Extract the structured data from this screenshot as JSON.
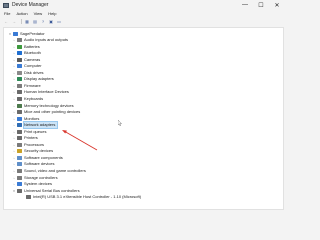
{
  "window": {
    "title": "Device Manager",
    "minimize_glyph": "—",
    "maximize_glyph": "☐",
    "close_glyph": "✕"
  },
  "menubar": {
    "items": [
      "File",
      "Action",
      "View",
      "Help"
    ]
  },
  "toolbar": {
    "buttons": [
      {
        "name": "back-icon",
        "glyph": "←"
      },
      {
        "name": "forward-icon",
        "glyph": "→"
      },
      {
        "name": "tree-view-icon",
        "glyph": "▦"
      },
      {
        "name": "properties-icon",
        "glyph": "▤"
      },
      {
        "name": "help-icon",
        "glyph": "?"
      },
      {
        "name": "scan-icon",
        "glyph": "▣"
      },
      {
        "name": "monitor-icon",
        "glyph": "▭"
      }
    ]
  },
  "tree": {
    "root": "SagePredator",
    "items": [
      {
        "label": "Audio inputs and outputs",
        "icon": "speaker-icon",
        "color": "#7a7a7a"
      },
      {
        "label": "Batteries",
        "icon": "battery-icon",
        "color": "#3d9a3d"
      },
      {
        "label": "Bluetooth",
        "icon": "bluetooth-icon",
        "color": "#1f6fd1"
      },
      {
        "label": "Cameras",
        "icon": "camera-icon",
        "color": "#5a5a5a"
      },
      {
        "label": "Computer",
        "icon": "computer-icon",
        "color": "#3a7bd5"
      },
      {
        "label": "Disk drives",
        "icon": "disk-drive-icon",
        "color": "#8a8a8a"
      },
      {
        "label": "Display adapters",
        "icon": "display-adapter-icon",
        "color": "#2e8b57"
      },
      {
        "label": "Firmware",
        "icon": "firmware-icon",
        "color": "#7c7c7c"
      },
      {
        "label": "Human Interface Devices",
        "icon": "hid-icon",
        "color": "#6a6a6a"
      },
      {
        "label": "Keyboards",
        "icon": "keyboard-icon",
        "color": "#6a6a6a"
      },
      {
        "label": "Memory technology devices",
        "icon": "memory-icon",
        "color": "#4d7a4d"
      },
      {
        "label": "Mice and other pointing devices",
        "icon": "mouse-icon",
        "color": "#6a6a6a"
      },
      {
        "label": "Monitors",
        "icon": "monitor-icon",
        "color": "#3a7bd5"
      },
      {
        "label": "Network adapters",
        "icon": "network-adapter-icon",
        "color": "#2f6db5"
      },
      {
        "label": "Print queues",
        "icon": "printer-icon",
        "color": "#6a6a6a"
      },
      {
        "label": "Printers",
        "icon": "printer-icon",
        "color": "#6a6a6a"
      },
      {
        "label": "Processors",
        "icon": "processor-icon",
        "color": "#7a7a7a"
      },
      {
        "label": "Security devices",
        "icon": "security-icon",
        "color": "#c9a227"
      },
      {
        "label": "Software components",
        "icon": "software-icon",
        "color": "#5f8fc9"
      },
      {
        "label": "Software devices",
        "icon": "software-icon",
        "color": "#5f8fc9"
      },
      {
        "label": "Sound, video and game controllers",
        "icon": "sound-icon",
        "color": "#7a7a7a"
      },
      {
        "label": "Storage controllers",
        "icon": "storage-icon",
        "color": "#7a7a7a"
      },
      {
        "label": "System devices",
        "icon": "system-icon",
        "color": "#3a7bd5"
      },
      {
        "label": "Universal Serial Bus controllers",
        "icon": "usb-icon",
        "color": "#6a6a6a"
      },
      {
        "label": "Intel(R) USB 3.1 eXtensible Host Controller - 1.10 (Microsoft)",
        "icon": "usb-icon",
        "color": "#6a6a6a"
      }
    ],
    "selected_label": "Network adapters"
  },
  "colors": {
    "selection": "#cce4f7",
    "annotation_arrow": "#d9342b"
  }
}
